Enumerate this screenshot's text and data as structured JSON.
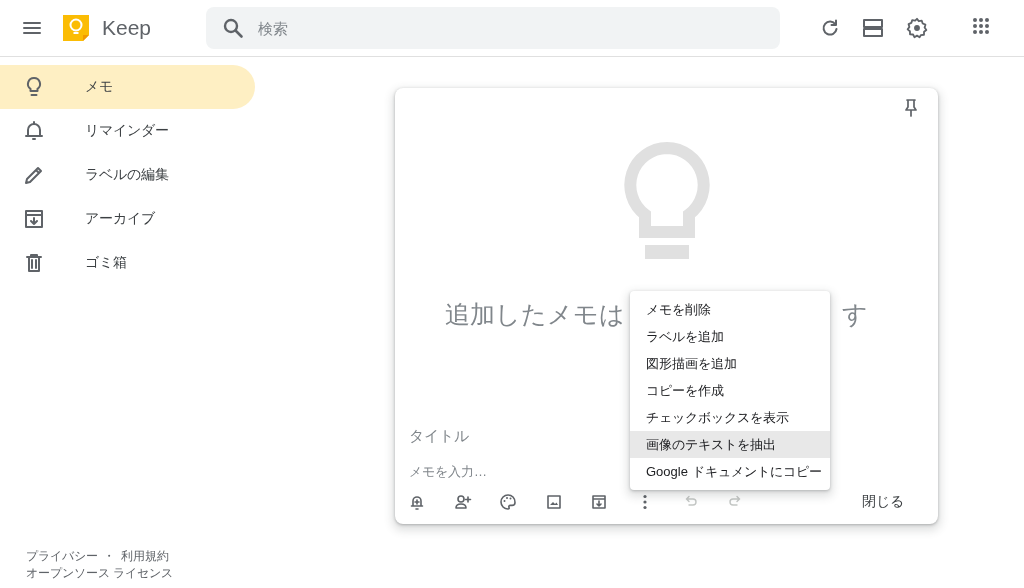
{
  "header": {
    "app_name": "Keep",
    "search": {
      "placeholder": "検索"
    }
  },
  "sidebar": {
    "items": [
      {
        "label": "メモ",
        "selected": true
      },
      {
        "label": "リマインダー",
        "selected": false
      },
      {
        "label": "ラベルの編集",
        "selected": false
      },
      {
        "label": "アーカイブ",
        "selected": false
      },
      {
        "label": "ゴミ箱",
        "selected": false
      }
    ]
  },
  "footer": {
    "links": [
      "プライバシー",
      "利用規約",
      "オープンソース ライセンス"
    ],
    "separator": "・"
  },
  "note_editor": {
    "empty_message_start": "追加したメモは",
    "empty_message_end": "す",
    "title": {
      "placeholder": "タイトル"
    },
    "body": {
      "placeholder": "メモを入力…"
    },
    "undo": {
      "disabled": true
    },
    "redo": {
      "disabled": true
    },
    "close_label": "閉じる"
  },
  "context_menu": {
    "items": [
      {
        "label": "メモを削除",
        "selected": false
      },
      {
        "label": "ラベルを追加",
        "selected": false
      },
      {
        "label": "図形描画を追加",
        "selected": false
      },
      {
        "label": "コピーを作成",
        "selected": false
      },
      {
        "label": "チェックボックスを表示",
        "selected": false
      },
      {
        "label": "画像のテキストを抽出",
        "selected": true
      },
      {
        "label": "Google ドキュメントにコピー",
        "selected": false
      }
    ]
  }
}
